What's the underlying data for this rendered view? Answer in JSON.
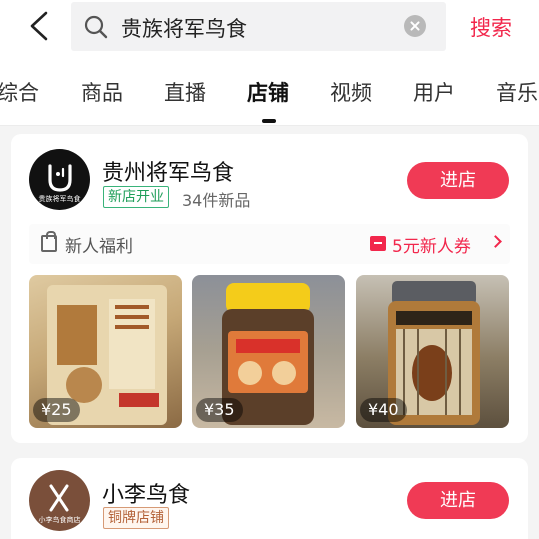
{
  "search": {
    "query": "贵族将军鸟食",
    "button_label": "搜索"
  },
  "tabs": [
    {
      "label": "综合",
      "active": false
    },
    {
      "label": "商品",
      "active": false
    },
    {
      "label": "直播",
      "active": false
    },
    {
      "label": "店铺",
      "active": true
    },
    {
      "label": "视频",
      "active": false
    },
    {
      "label": "用户",
      "active": false
    },
    {
      "label": "音乐",
      "active": false
    }
  ],
  "shops": [
    {
      "name": "贵州将军鸟食",
      "avatar_text": "贵族将军鸟食",
      "badge": "新店开业",
      "new_products": "34件新品",
      "enter_label": "进店",
      "welfare": {
        "label": "新人福利",
        "coupon": "5元新人券"
      },
      "products": [
        {
          "price": "¥25"
        },
        {
          "price": "¥35"
        },
        {
          "price": "¥40"
        }
      ]
    },
    {
      "name": "小李鸟食",
      "avatar_text": "小李鸟食商店",
      "badge": "铜牌店铺",
      "enter_label": "进店"
    }
  ],
  "colors": {
    "accent": "#f2274c",
    "enter_button": "#f03a55",
    "new_badge": "#1f9e5a",
    "bronze_badge": "#b4633a"
  },
  "icons": [
    "back-arrow-icon",
    "search-icon",
    "clear-icon",
    "bag-icon",
    "coupon-icon",
    "chevron-right-icon",
    "bird-logo-icon",
    "fork-knife-icon"
  ]
}
